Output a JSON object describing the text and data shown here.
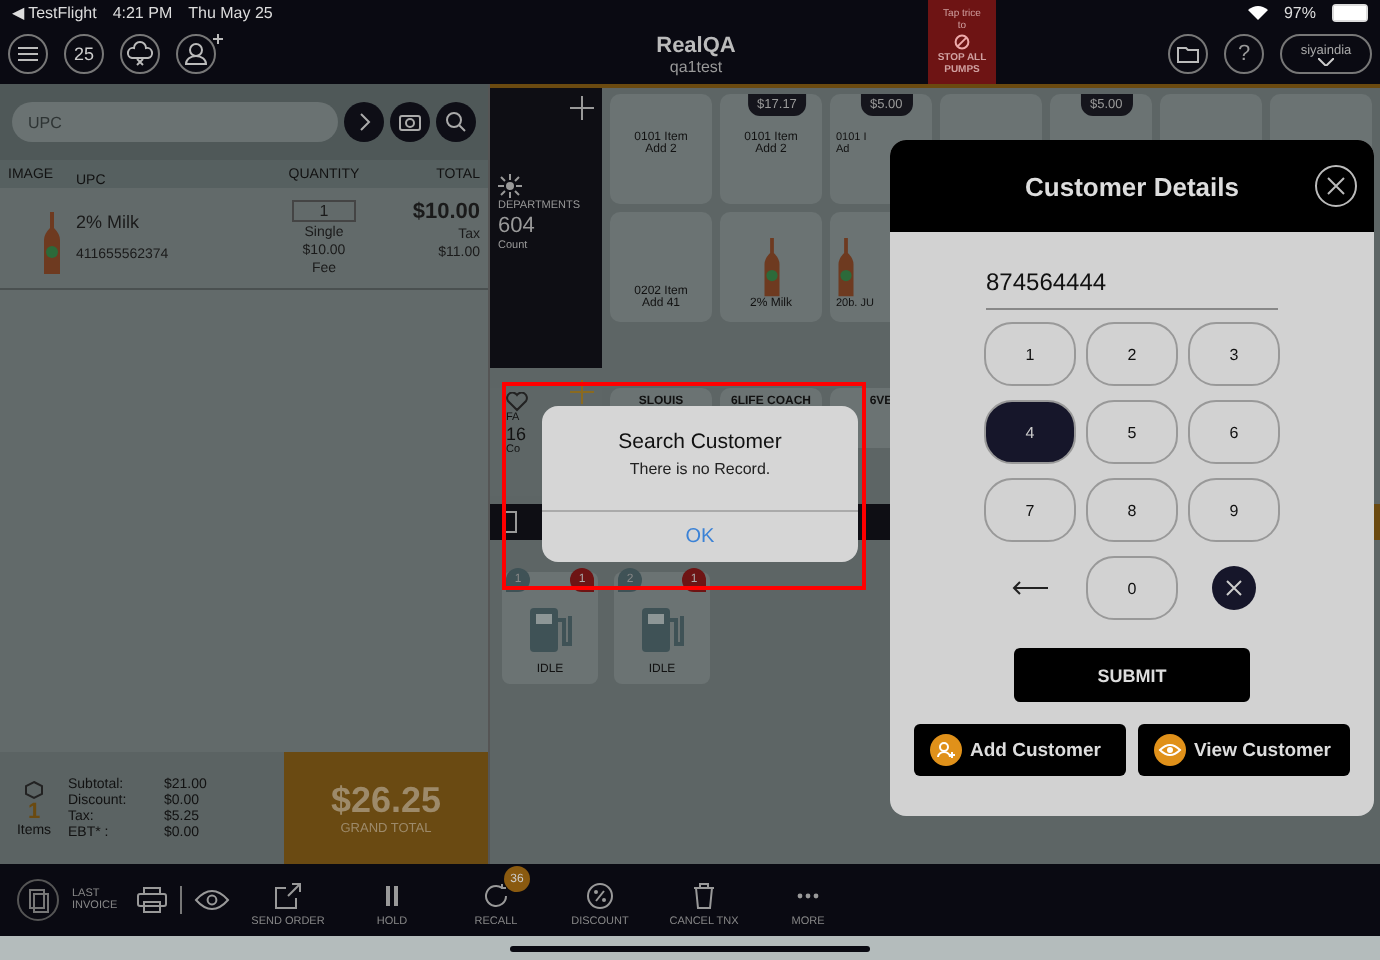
{
  "status_bar": {
    "back": "◀ TestFlight",
    "time": "4:21 PM",
    "date": "Thu May 25",
    "battery": "97%"
  },
  "header": {
    "calendar_day": "25",
    "title": "RealQA",
    "subtitle": "qa1test",
    "stop_hint": "Tap trice to",
    "stop_label": "STOP ALL PUMPS",
    "help": "?",
    "user": "siyaindia"
  },
  "search": {
    "placeholder": "UPC"
  },
  "cart": {
    "columns": [
      "IMAGE",
      "UPC",
      "QUANTITY",
      "TOTAL"
    ],
    "rows": [
      {
        "name": "2% Milk",
        "upc": "411655562374",
        "quantity": "1",
        "unit": "Single",
        "price": "$10.00",
        "fee": "Fee",
        "total": "$10.00",
        "tax_label": "Tax",
        "total_with_tax": "$11.00"
      }
    ]
  },
  "summary": {
    "count": "1",
    "count_label": "Items",
    "lines": [
      {
        "label": "Subtotal:",
        "value": "$21.00"
      },
      {
        "label": "Discount:",
        "value": "$0.00"
      },
      {
        "label": "Tax:",
        "value": "$5.25"
      },
      {
        "label": "EBT* :",
        "value": "$0.00"
      }
    ],
    "grand_total": "$26.25",
    "grand_total_label": "GRAND TOTAL"
  },
  "departments": {
    "label": "DEPARTMENTS",
    "count": "604",
    "count_label": "Count"
  },
  "tiles": [
    {
      "kind": "text",
      "lines": [
        "0101 Item",
        "Add 2"
      ]
    },
    {
      "kind": "text",
      "price": "$17.17",
      "lines": [
        "0101 Item",
        "Add 2"
      ]
    },
    {
      "kind": "text",
      "price": "$5.00",
      "lines": [
        "0101 I",
        "Ad"
      ]
    },
    {
      "kind": "blank"
    },
    {
      "kind": "blank",
      "price": "$5.00"
    },
    {
      "kind": "blank"
    },
    {
      "kind": "blank"
    },
    {
      "kind": "text",
      "lines": [
        "0202 Item",
        "Add 41"
      ]
    },
    {
      "kind": "bottle",
      "lines": [
        "2% Milk"
      ]
    },
    {
      "kind": "bottle",
      "lines": [
        "20b. JU"
      ]
    }
  ],
  "favorites": {
    "label": "FA",
    "count": "16",
    "count_label": "Co"
  },
  "tiles_2": [
    {
      "label": "SLOUIS"
    },
    {
      "label": "6LIFE COACH"
    },
    {
      "label": "6VE"
    }
  ],
  "pumps": [
    {
      "number": "1",
      "alerts": "1",
      "status": "IDLE"
    },
    {
      "number": "2",
      "alerts": "1",
      "status": "IDLE"
    }
  ],
  "toolbar": {
    "last_invoice": "LAST INVOICE",
    "items": [
      {
        "kind": "send",
        "label": "SEND ORDER"
      },
      {
        "kind": "hold",
        "label": "HOLD"
      },
      {
        "kind": "recall",
        "label": "RECALL",
        "badge": "36"
      },
      {
        "kind": "discount",
        "label": "DISCOUNT"
      },
      {
        "kind": "cancel",
        "label": "CANCEL TNX"
      },
      {
        "kind": "more",
        "label": "MORE"
      }
    ]
  },
  "customer_dialog": {
    "title": "Customer Details",
    "value": "874564444",
    "keys": [
      {
        "label": "1",
        "selected": false
      },
      {
        "label": "2",
        "selected": false
      },
      {
        "label": "3",
        "selected": false
      },
      {
        "label": "4",
        "selected": true
      },
      {
        "label": "5",
        "selected": false
      },
      {
        "label": "6",
        "selected": false
      },
      {
        "label": "7",
        "selected": false
      },
      {
        "label": "8",
        "selected": false
      },
      {
        "label": "9",
        "selected": false
      },
      {
        "label": "0",
        "selected": false
      }
    ],
    "submit": "SUBMIT",
    "add": "Add Customer",
    "view": "View Customer"
  },
  "alert": {
    "title": "Search Customer",
    "message": "There is no Record.",
    "button": "OK"
  }
}
